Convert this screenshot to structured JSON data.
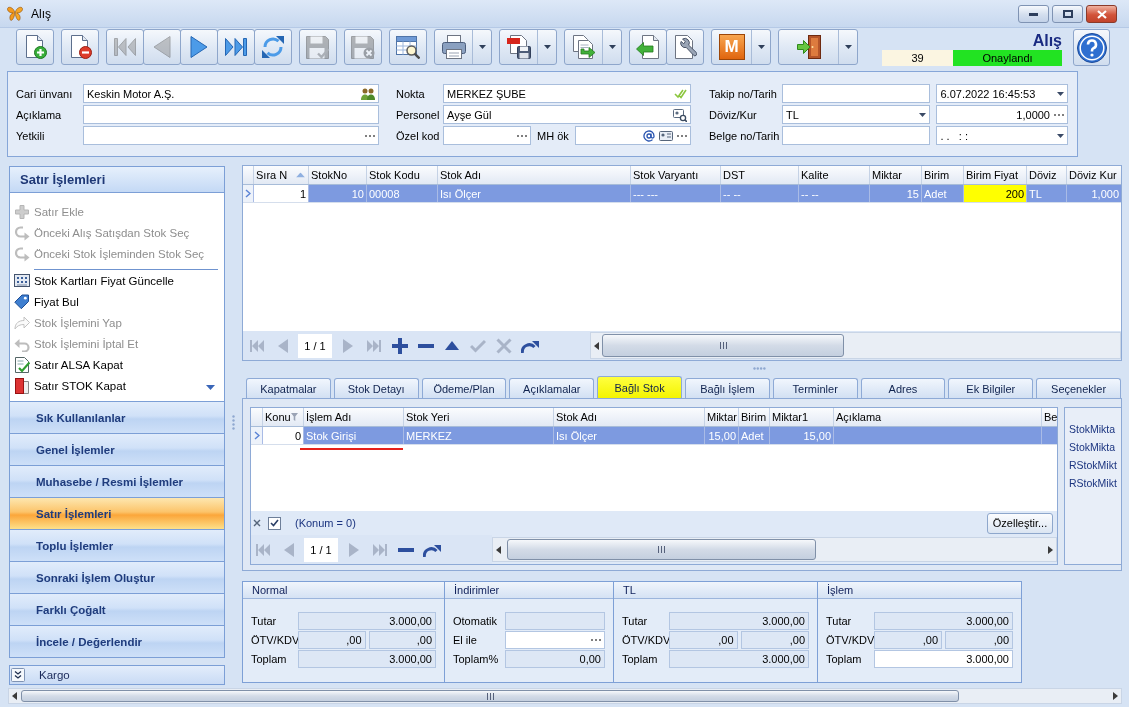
{
  "window": {
    "title": "Alış"
  },
  "toolbar": {
    "groups": [
      [
        {
          "kind": "new",
          "disabled": false,
          "dropdown": false
        }
      ],
      [
        {
          "kind": "delete",
          "disabled": false,
          "dropdown": false
        }
      ],
      [
        {
          "kind": "first",
          "disabled": true,
          "dropdown": false
        },
        {
          "kind": "previous",
          "disabled": true,
          "dropdown": false
        },
        {
          "kind": "next",
          "disabled": false,
          "dropdown": false
        },
        {
          "kind": "last",
          "disabled": false,
          "dropdown": false
        },
        {
          "kind": "refresh",
          "disabled": false,
          "dropdown": false
        }
      ],
      [
        {
          "kind": "save",
          "disabled": true,
          "dropdown": false
        }
      ],
      [
        {
          "kind": "save-cancel",
          "disabled": true,
          "dropdown": false
        }
      ],
      [
        {
          "kind": "grid-search",
          "disabled": false,
          "dropdown": false
        }
      ],
      [
        {
          "kind": "print",
          "disabled": false,
          "dropdown": true
        }
      ],
      [
        {
          "kind": "pdf",
          "disabled": false,
          "dropdown": true
        }
      ],
      [
        {
          "kind": "export",
          "disabled": false,
          "dropdown": true
        }
      ],
      [
        {
          "kind": "import",
          "disabled": false,
          "dropdown": false
        },
        {
          "kind": "settings",
          "disabled": false,
          "dropdown": false
        }
      ],
      [
        {
          "kind": "letter",
          "label": "M",
          "disabled": false,
          "dropdown": true
        }
      ],
      [
        {
          "kind": "exit",
          "disabled": false,
          "dropdown": true
        }
      ]
    ],
    "document_title": "Alış",
    "record_no": "39",
    "status": "Onaylandı"
  },
  "header_form": {
    "rows": [
      {
        "groups": [
          {
            "label": "Cari ünvanı",
            "fields": [
              {
                "kind": "contact",
                "value": "Keskin Motor A.Ş."
              }
            ]
          },
          {
            "label": "Nokta",
            "fields": [
              {
                "kind": "verified",
                "value": "MERKEZ ŞUBE"
              }
            ]
          },
          {
            "label": "Takip no/Tarih",
            "fields": [
              {
                "kind": "text"
              },
              {
                "kind": "dropdown",
                "value": "6.07.2022 16:45:53"
              }
            ]
          }
        ]
      },
      {
        "groups": [
          {
            "label": "Açıklama",
            "fields": [
              {
                "kind": "text"
              }
            ]
          },
          {
            "label": "Personel",
            "fields": [
              {
                "kind": "person-lookup",
                "value": "Ayşe Gül"
              }
            ]
          },
          {
            "label": "Döviz/Kur",
            "fields": [
              {
                "kind": "dropdown",
                "value": "TL"
              },
              {
                "kind": "number",
                "value": "1,0000"
              }
            ]
          }
        ]
      },
      {
        "groups": [
          {
            "label": "Yetkili",
            "fields": [
              {
                "kind": "ellipsis"
              }
            ]
          },
          {
            "label": "Özel kod",
            "fields": [
              {
                "kind": "ellipsis"
              },
              {
                "kind": "email",
                "label": "MH ök"
              }
            ]
          },
          {
            "label": "Belge no/Tarih",
            "fields": [
              {
                "kind": "text"
              },
              {
                "kind": "dropdown",
                "value": ". .   : :"
              }
            ]
          }
        ]
      }
    ]
  },
  "sidebar": {
    "title": "Satır İşlemleri",
    "actions": [
      {
        "kind": "add",
        "label": "Satır Ekle",
        "disabled": true
      },
      {
        "kind": "redo",
        "label": "Önceki Alış Satışdan Stok Seç",
        "disabled": true
      },
      {
        "kind": "redo",
        "label": "Önceki Stok İşleminden Stok Seç",
        "disabled": true
      },
      {
        "kind": "separator"
      },
      {
        "kind": "grid",
        "label": "Stok Kartları Fiyat Güncelle",
        "disabled": false
      },
      {
        "kind": "price-tag",
        "label": "Fiyat Bul",
        "disabled": false
      },
      {
        "kind": "forward",
        "label": "Stok İşlemini Yap",
        "disabled": true
      },
      {
        "kind": "undo",
        "label": "Stok İşlemini İptal Et",
        "disabled": true
      },
      {
        "kind": "document-check",
        "label": "Satır ALSA Kapat",
        "disabled": false
      },
      {
        "kind": "document-red",
        "label": "Satır STOK Kapat",
        "disabled": false
      }
    ],
    "groups": [
      {
        "label": "Sık Kullanılanlar",
        "selected": false
      },
      {
        "label": "Genel İşlemler",
        "selected": false
      },
      {
        "label": "Muhasebe / Resmi İşlemler",
        "selected": false
      },
      {
        "label": "Satır İşlemleri",
        "selected": true
      },
      {
        "label": "Toplu İşlemler",
        "selected": false
      },
      {
        "label": "Sonraki İşlem Oluştur",
        "selected": false
      },
      {
        "label": "Farklı Çoğalt",
        "selected": false
      },
      {
        "label": "İncele / Değerlendir",
        "selected": false
      }
    ],
    "footer": {
      "label": "Kargo",
      "expanded": false
    }
  },
  "lines_grid": {
    "columns": [
      {
        "label": "Sıra N",
        "kind": "number",
        "sorted": true
      },
      {
        "label": "StokNo",
        "kind": "number",
        "sorted": false
      },
      {
        "label": "Stok Kodu",
        "kind": "text",
        "sorted": false
      },
      {
        "label": "Stok Adı",
        "kind": "text",
        "sorted": false
      },
      {
        "label": "Stok Varyantı",
        "kind": "text",
        "sorted": false
      },
      {
        "label": "DST",
        "kind": "text",
        "sorted": false
      },
      {
        "label": "Kalite",
        "kind": "text",
        "sorted": false
      },
      {
        "label": "Miktar",
        "kind": "number",
        "sorted": false
      },
      {
        "label": "Birim",
        "kind": "text",
        "sorted": false
      },
      {
        "label": "Birim Fiyat",
        "kind": "number",
        "sorted": false
      },
      {
        "label": "Döviz",
        "kind": "text",
        "sorted": false
      },
      {
        "label": "Döviz Kur",
        "kind": "number",
        "sorted": false
      }
    ],
    "rows": [
      {
        "selected": true,
        "cells": [
          {
            "text": "1",
            "focused": true,
            "highlighted": false
          },
          {
            "text": "10",
            "focused": false,
            "highlighted": false
          },
          {
            "text": "00008",
            "focused": false,
            "highlighted": false
          },
          {
            "text": "Isı Ölçer",
            "focused": false,
            "highlighted": false
          },
          {
            "text": "--- ---",
            "focused": false,
            "highlighted": false
          },
          {
            "text": "-- --",
            "focused": false,
            "highlighted": false
          },
          {
            "text": "-- --",
            "focused": false,
            "highlighted": false
          },
          {
            "text": "15",
            "focused": false,
            "highlighted": false
          },
          {
            "text": "Adet",
            "focused": false,
            "highlighted": false
          },
          {
            "text": "200",
            "focused": false,
            "highlighted": true
          },
          {
            "text": "TL",
            "focused": false,
            "highlighted": false
          },
          {
            "text": "1,000",
            "focused": false,
            "highlighted": false
          }
        ]
      }
    ],
    "navigator": {
      "buttons_before": [
        {
          "kind": "first",
          "disabled": true
        },
        {
          "kind": "previous",
          "disabled": true
        }
      ],
      "position": "1 / 1",
      "buttons_after": [
        {
          "kind": "next",
          "disabled": true
        },
        {
          "kind": "last",
          "disabled": true
        },
        {
          "kind": "add",
          "disabled": false
        },
        {
          "kind": "remove",
          "disabled": false
        },
        {
          "kind": "edit",
          "disabled": false
        },
        {
          "kind": "confirm",
          "disabled": true
        },
        {
          "kind": "cancel",
          "disabled": true
        },
        {
          "kind": "refresh",
          "disabled": false
        }
      ]
    }
  },
  "tabs": [
    {
      "label": "Kapatmalar",
      "selected": false
    },
    {
      "label": "Stok Detayı",
      "selected": false
    },
    {
      "label": "Ödeme/Plan",
      "selected": false
    },
    {
      "label": "Açıklamalar",
      "selected": false
    },
    {
      "label": "Bağlı Stok",
      "selected": true
    },
    {
      "label": "Bağlı İşlem",
      "selected": false
    },
    {
      "label": "Terminler",
      "selected": false
    },
    {
      "label": "Adres",
      "selected": false
    },
    {
      "label": "Ek Bilgiler",
      "selected": false
    },
    {
      "label": "Seçenekler",
      "selected": false
    }
  ],
  "linked_stock": {
    "columns": [
      {
        "label": "Konu",
        "kind": "number",
        "filter": true
      },
      {
        "label": "İşlem Adı",
        "kind": "text",
        "filter": false
      },
      {
        "label": "Stok Yeri",
        "kind": "text",
        "filter": false
      },
      {
        "label": "Stok Adı",
        "kind": "text",
        "filter": false
      },
      {
        "label": "Miktar",
        "kind": "number",
        "filter": false
      },
      {
        "label": "Birim",
        "kind": "text",
        "filter": false
      },
      {
        "label": "Miktar1",
        "kind": "number",
        "filter": false
      },
      {
        "label": "Açıklama",
        "kind": "text",
        "filter": false
      },
      {
        "label": "Be",
        "kind": "text",
        "filter": false
      }
    ],
    "rows": [
      {
        "selected": true,
        "cells": [
          {
            "kind": "plain",
            "text": "0",
            "focused": true
          },
          {
            "kind": "underlined",
            "text": "Stok Girişi",
            "focused": false
          },
          {
            "kind": "plain",
            "text": "MERKEZ",
            "focused": false
          },
          {
            "kind": "plain",
            "text": "Isı Ölçer",
            "focused": false
          },
          {
            "kind": "plain",
            "text": "15,00",
            "focused": false
          },
          {
            "kind": "plain",
            "text": "Adet",
            "focused": false
          },
          {
            "kind": "plain",
            "text": "15,00",
            "focused": false
          },
          {
            "kind": "plain",
            "focused": false
          },
          {
            "kind": "plain",
            "focused": false
          }
        ]
      }
    ],
    "filter_bar": {
      "enabled": true,
      "text": "(Konum = 0)",
      "button": "Özelleştir..."
    },
    "navigator": {
      "buttons_before": [
        {
          "kind": "first",
          "disabled": true
        },
        {
          "kind": "previous",
          "disabled": true
        }
      ],
      "position": "1 / 1",
      "buttons_after": [
        {
          "kind": "next",
          "disabled": true
        },
        {
          "kind": "last",
          "disabled": true
        },
        {
          "kind": "remove",
          "disabled": false
        },
        {
          "kind": "refresh",
          "disabled": false
        }
      ]
    },
    "side_labels": [
      "StokMikta",
      "StokMikta",
      "RStokMikt",
      "RStokMikt"
    ]
  },
  "totals": [
    {
      "title": "Normal",
      "rows": [
        {
          "label": "Tutar",
          "fields": [
            {
              "kind": "text",
              "value": "3.000,00",
              "editable": false
            }
          ]
        },
        {
          "label": "ÖTV/KDV",
          "fields": [
            {
              "kind": "text",
              "value": ",00",
              "editable": false
            },
            {
              "kind": "text",
              "value": ",00",
              "editable": false
            }
          ]
        },
        {
          "label": "Toplam",
          "fields": [
            {
              "kind": "text",
              "value": "3.000,00",
              "editable": false
            }
          ]
        }
      ]
    },
    {
      "title": "İndirimler",
      "rows": [
        {
          "label": "Otomatik",
          "fields": [
            {
              "kind": "text",
              "editable": false
            }
          ]
        },
        {
          "label": "El ile",
          "fields": [
            {
              "kind": "ellipsis",
              "editable": true
            }
          ]
        },
        {
          "label": "Toplam%",
          "fields": [
            {
              "kind": "text",
              "value": "0,00",
              "editable": false
            }
          ]
        }
      ]
    },
    {
      "title": "TL",
      "rows": [
        {
          "label": "Tutar",
          "fields": [
            {
              "kind": "text",
              "value": "3.000,00",
              "editable": false
            }
          ]
        },
        {
          "label": "ÖTV/KDV",
          "fields": [
            {
              "kind": "text",
              "value": ",00",
              "editable": false
            },
            {
              "kind": "text",
              "value": ",00",
              "editable": false
            }
          ]
        },
        {
          "label": "Toplam",
          "fields": [
            {
              "kind": "text",
              "value": "3.000,00",
              "editable": false
            }
          ]
        }
      ]
    },
    {
      "title": "İşlem",
      "rows": [
        {
          "label": "Tutar",
          "fields": [
            {
              "kind": "text",
              "value": "3.000,00",
              "editable": false
            }
          ]
        },
        {
          "label": "ÖTV/KDV",
          "fields": [
            {
              "kind": "text",
              "value": ",00",
              "editable": false
            },
            {
              "kind": "text",
              "value": ",00",
              "editable": false
            }
          ]
        },
        {
          "label": "Toplam",
          "fields": [
            {
              "kind": "text",
              "value": "3.000,00",
              "editable": true
            }
          ]
        }
      ]
    }
  ]
}
